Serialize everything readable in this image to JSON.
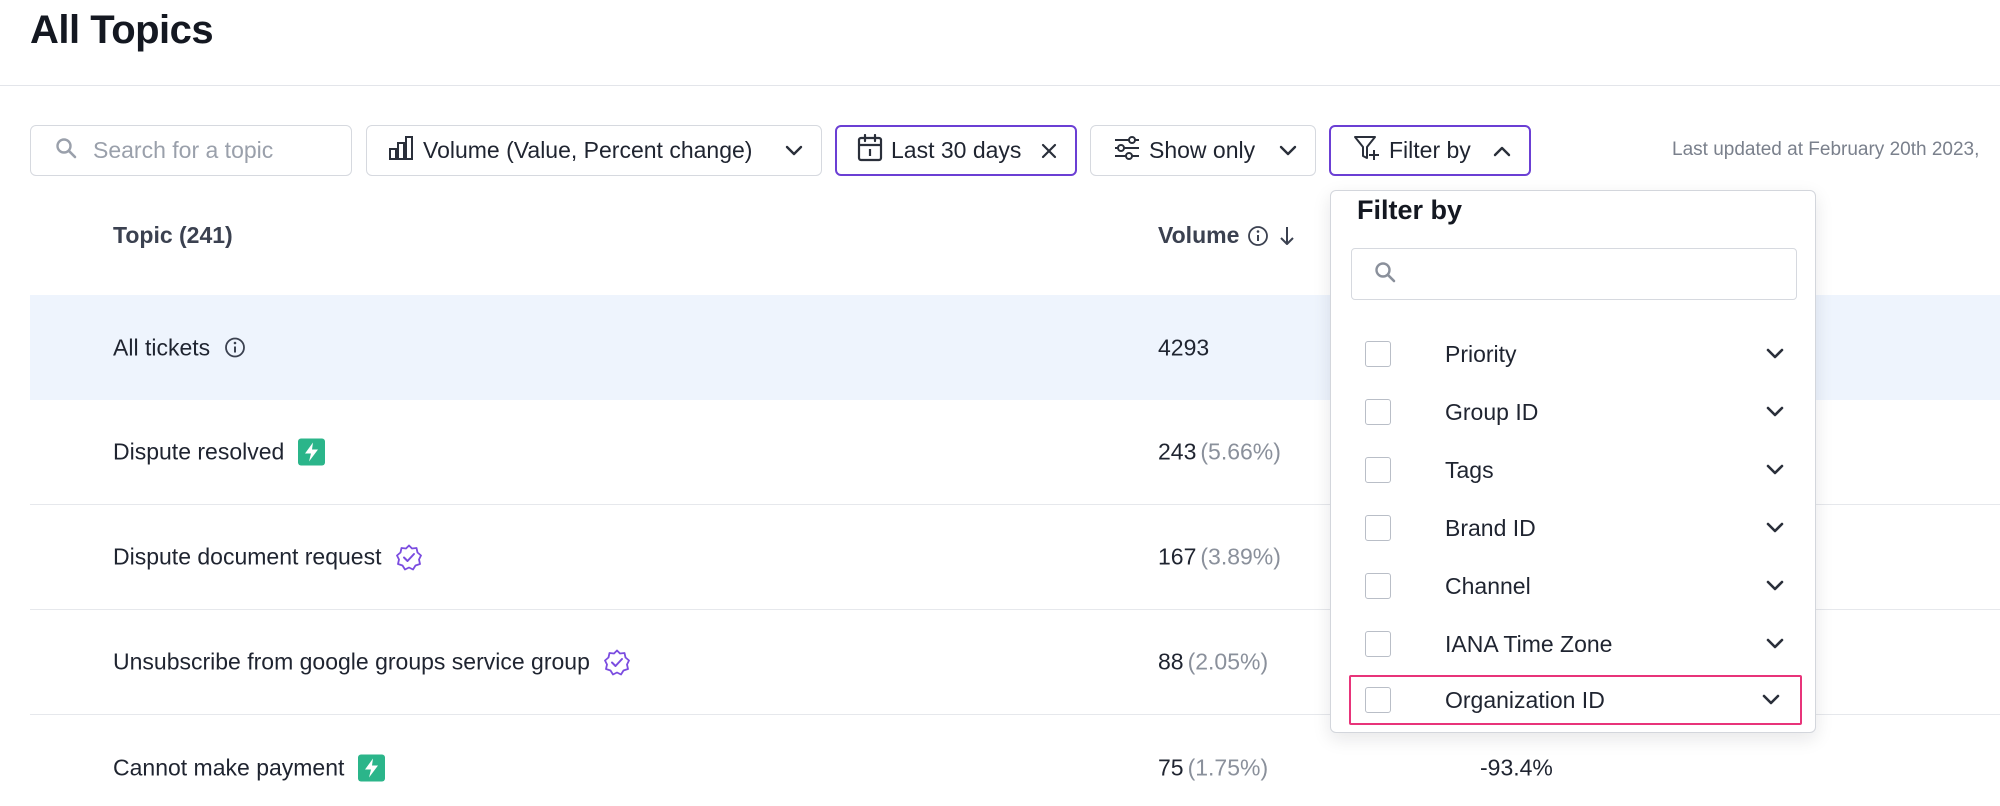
{
  "page": {
    "title": "All Topics"
  },
  "toolbar": {
    "search_placeholder": "Search for a topic",
    "volume_label": "Volume (Value, Percent change)",
    "date_label": "Last 30 days",
    "show_only_label": "Show only",
    "filter_by_label": "Filter by",
    "last_updated": "Last updated at February 20th 2023,",
    "accent_color": "#6b3fd4"
  },
  "table": {
    "headers": {
      "topic": "Topic (241)",
      "volume": "Volume"
    },
    "rows": [
      {
        "topic": "All tickets",
        "badge": "info-icon",
        "volume": "4293",
        "percent": "",
        "change": ""
      },
      {
        "topic": "Dispute resolved",
        "badge": "bolt-icon",
        "volume": "243",
        "percent": "(5.66%)",
        "change": ""
      },
      {
        "topic": "Dispute document request",
        "badge": "verified-icon",
        "volume": "167",
        "percent": "(3.89%)",
        "change": ""
      },
      {
        "topic": "Unsubscribe from google groups service group",
        "badge": "verified-icon",
        "volume": "88",
        "percent": "(2.05%)",
        "change": ""
      },
      {
        "topic": "Cannot make payment",
        "badge": "bolt-icon",
        "volume": "75",
        "percent": "(1.75%)",
        "change": "-93.4%"
      }
    ]
  },
  "filter_dropdown": {
    "title": "Filter by",
    "search_placeholder": "",
    "highlight_color": "#e8347a",
    "items": [
      {
        "label": "Priority",
        "checked": false
      },
      {
        "label": "Group ID",
        "checked": false
      },
      {
        "label": "Tags",
        "checked": false
      },
      {
        "label": "Brand ID",
        "checked": false
      },
      {
        "label": "Channel",
        "checked": false
      },
      {
        "label": "IANA Time Zone",
        "checked": false
      },
      {
        "label": "Organization ID",
        "checked": false,
        "highlighted": true
      }
    ]
  }
}
